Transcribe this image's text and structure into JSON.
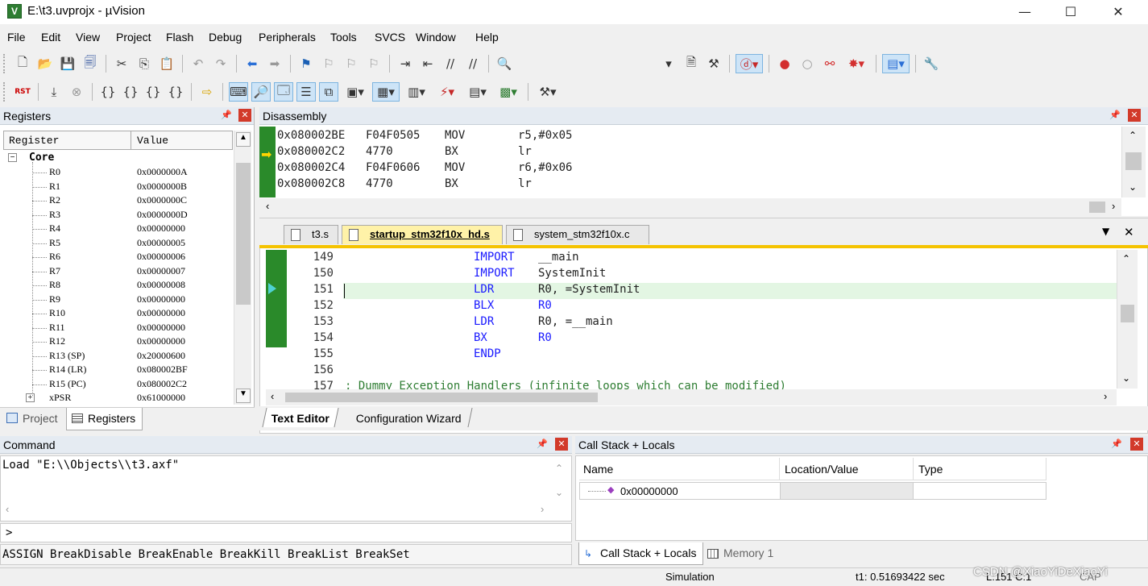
{
  "window": {
    "title": "E:\\t3.uvprojx - µVision",
    "app_icon_letter": "V"
  },
  "menu": [
    "File",
    "Edit",
    "View",
    "Project",
    "Flash",
    "Debug",
    "Peripherals",
    "Tools",
    "SVCS",
    "Window",
    "Help"
  ],
  "toolbar2": {
    "reset_label": "RST"
  },
  "registers": {
    "title": "Registers",
    "col_register": "Register",
    "col_value": "Value",
    "group": "Core",
    "rows": [
      {
        "name": "R0",
        "value": "0x0000000A"
      },
      {
        "name": "R1",
        "value": "0x0000000B"
      },
      {
        "name": "R2",
        "value": "0x0000000C"
      },
      {
        "name": "R3",
        "value": "0x0000000D"
      },
      {
        "name": "R4",
        "value": "0x00000000"
      },
      {
        "name": "R5",
        "value": "0x00000005"
      },
      {
        "name": "R6",
        "value": "0x00000006"
      },
      {
        "name": "R7",
        "value": "0x00000007"
      },
      {
        "name": "R8",
        "value": "0x00000008"
      },
      {
        "name": "R9",
        "value": "0x00000000"
      },
      {
        "name": "R10",
        "value": "0x00000000"
      },
      {
        "name": "R11",
        "value": "0x00000000"
      },
      {
        "name": "R12",
        "value": "0x00000000"
      },
      {
        "name": "R13 (SP)",
        "value": "0x20000600"
      },
      {
        "name": "R14 (LR)",
        "value": "0x080002BF"
      },
      {
        "name": "R15 (PC)",
        "value": "0x080002C2"
      },
      {
        "name": "xPSR",
        "value": "0x61000000"
      }
    ],
    "bottom_tabs": [
      "Project",
      "Registers"
    ]
  },
  "disassembly": {
    "title": "Disassembly",
    "lines": [
      {
        "addr": "0x080002BE",
        "code": "F04F0505",
        "op": "MOV",
        "args": "r5,#0x05"
      },
      {
        "addr": "0x080002C2",
        "code": "4770",
        "op": "BX",
        "args": "lr"
      },
      {
        "addr": "0x080002C4",
        "code": "F04F0606",
        "op": "MOV",
        "args": "r6,#0x06"
      },
      {
        "addr": "0x080002C8",
        "code": "4770",
        "op": "BX",
        "args": "lr"
      }
    ]
  },
  "editor": {
    "tabs": [
      "t3.s",
      "startup_stm32f10x_hd.s",
      "system_stm32f10x.c"
    ],
    "lines": [
      {
        "num": "149",
        "kw": "IMPORT",
        "rest": "__main"
      },
      {
        "num": "150",
        "kw": "IMPORT",
        "rest": "SystemInit"
      },
      {
        "num": "151",
        "kw": "LDR",
        "rest": "R0, =SystemInit"
      },
      {
        "num": "152",
        "kw": "BLX",
        "rest": "R0"
      },
      {
        "num": "153",
        "kw": "LDR",
        "rest": "R0, =__main"
      },
      {
        "num": "154",
        "kw": "BX",
        "rest": "R0"
      },
      {
        "num": "155",
        "kw": "ENDP",
        "rest": ""
      },
      {
        "num": "156",
        "kw": "",
        "rest": ""
      },
      {
        "num": "157",
        "kw": "",
        "rest": "; Dummy Exception Handlers (infinite loops which can be modified)"
      }
    ],
    "bottom_tabs": [
      "Text Editor",
      "Configuration Wizard"
    ]
  },
  "command": {
    "title": "Command",
    "output": "Load \"E:\\\\Objects\\\\t3.axf\"",
    "prompt": ">",
    "hints": "ASSIGN BreakDisable BreakEnable BreakKill BreakList BreakSet"
  },
  "callstack": {
    "title": "Call Stack + Locals",
    "col_name": "Name",
    "col_location": "Location/Value",
    "col_type": "Type",
    "row_name": "0x00000000",
    "bottom_tabs": [
      "Call Stack + Locals",
      "Memory 1"
    ]
  },
  "status": {
    "mode": "Simulation",
    "time": "t1: 0.51693422 sec",
    "position": "L:151 C:1",
    "caps": "CAP",
    "watermark": "CSDN @XiaoYiDeXiaoYi"
  }
}
